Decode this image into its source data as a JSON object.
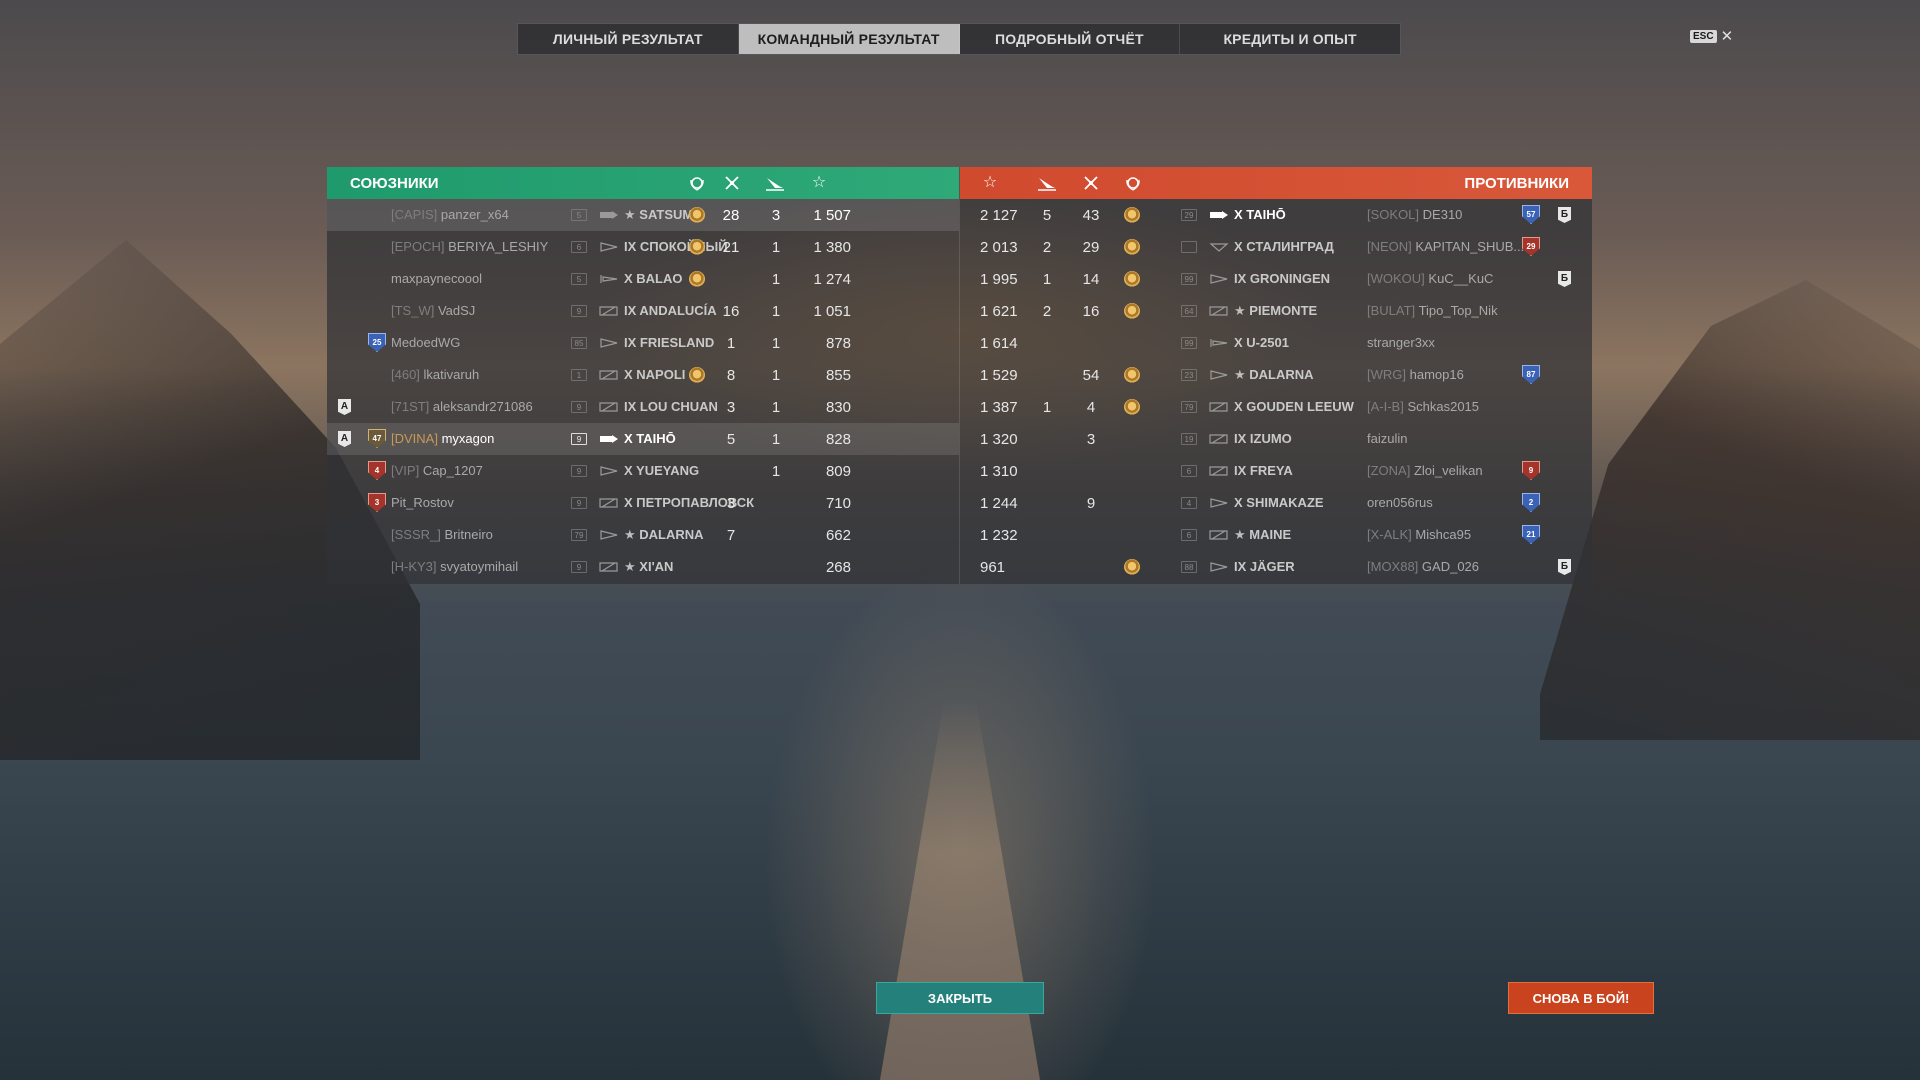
{
  "tabs": [
    {
      "label": "ЛИЧНЫЙ РЕЗУЛЬТАТ",
      "active": false
    },
    {
      "label": "КОМАНДНЫЙ РЕЗУЛЬТАТ",
      "active": true
    },
    {
      "label": "ПОДРОБНЫЙ ОТЧЁТ",
      "active": false
    },
    {
      "label": "КРЕДИТЫ И ОПЫТ",
      "active": false
    }
  ],
  "esc": {
    "key": "ESC",
    "close": "✕"
  },
  "allies": {
    "title": "СОЮЗНИКИ",
    "header_icons": [
      "medal-icon",
      "kills-icon",
      "ribbon-icon",
      "xp-star-icon"
    ],
    "color": "#2fa978",
    "rows": [
      {
        "division": "",
        "badge": "",
        "clan": "[CAPIS]",
        "name": "panzer_x64",
        "tier_badge": "5",
        "ship_class": "carrier",
        "ship": "SATSUMA",
        "ship_prefix": "★",
        "medal": true,
        "kills": "28",
        "ribbons": "3",
        "xp": "1 507",
        "highlight": "top"
      },
      {
        "division": "",
        "badge": "",
        "clan": "[EPOCH]",
        "name": "BERIYA_LESHIY",
        "tier_badge": "6",
        "ship_class": "destroyer",
        "ship": "IX СПОКОЙНЫЙ",
        "ship_prefix": "",
        "medal": true,
        "kills": "21",
        "ribbons": "1",
        "xp": "1 380",
        "highlight": ""
      },
      {
        "division": "",
        "badge": "",
        "clan": "",
        "name": "maxpaynecoool",
        "tier_badge": "5",
        "ship_class": "submarine",
        "ship": "X BALAO",
        "ship_prefix": "",
        "medal": true,
        "kills": "",
        "ribbons": "1",
        "xp": "1 274",
        "highlight": ""
      },
      {
        "division": "",
        "badge": "",
        "clan": "[TS_W]",
        "name": "VadSJ",
        "tier_badge": "9",
        "ship_class": "cruiser",
        "ship": "IX ANDALUCÍA",
        "ship_prefix": "",
        "medal": false,
        "kills": "16",
        "ribbons": "1",
        "xp": "1 051",
        "highlight": ""
      },
      {
        "division": "",
        "badge": "25",
        "badge_color": "blue",
        "clan": "",
        "name": "MedoedWG",
        "tier_badge": "85",
        "ship_class": "destroyer",
        "ship": "IX FRIESLAND",
        "ship_prefix": "",
        "medal": false,
        "kills": "1",
        "ribbons": "1",
        "xp": "878",
        "highlight": ""
      },
      {
        "division": "",
        "badge": "",
        "clan": "[460]",
        "name": "lkativaruh",
        "tier_badge": "1",
        "ship_class": "cruiser",
        "ship": "X NAPOLI",
        "ship_prefix": "",
        "medal": true,
        "kills": "8",
        "ribbons": "1",
        "xp": "855",
        "highlight": ""
      },
      {
        "division": "A",
        "badge": "",
        "clan": "[71ST]",
        "name": "aleksandr271086",
        "tier_badge": "9",
        "ship_class": "cruiser",
        "ship": "IX LOU CHUAN",
        "ship_prefix": "",
        "medal": false,
        "kills": "3",
        "ribbons": "1",
        "xp": "830",
        "highlight": ""
      },
      {
        "division": "A",
        "badge": "47",
        "badge_color": "gold",
        "clan": "[DVINA]",
        "name": "myxagon",
        "tier_badge": "9",
        "ship_class": "carrier",
        "ship": "X TAIHŌ",
        "ship_prefix": "",
        "medal": false,
        "kills": "5",
        "ribbons": "1",
        "xp": "828",
        "highlight": "self"
      },
      {
        "division": "",
        "badge": "4",
        "badge_color": "red",
        "clan": "[VIP]",
        "name": "Cap_1207",
        "tier_badge": "9",
        "ship_class": "destroyer",
        "ship": "X YUEYANG",
        "ship_prefix": "",
        "medal": false,
        "kills": "",
        "ribbons": "1",
        "xp": "809",
        "highlight": ""
      },
      {
        "division": "",
        "badge": "3",
        "badge_color": "red",
        "clan": "",
        "name": "Pit_Rostov",
        "tier_badge": "9",
        "ship_class": "cruiser",
        "ship": "X ПЕТРОПАВЛОВСК",
        "ship_prefix": "",
        "medal": false,
        "kills": "3",
        "ribbons": "",
        "xp": "710",
        "highlight": ""
      },
      {
        "division": "",
        "badge": "",
        "clan": "[SSSR_]",
        "name": "Britneiro",
        "tier_badge": "79",
        "ship_class": "destroyer",
        "ship": "DALARNA",
        "ship_prefix": "★",
        "medal": false,
        "kills": "7",
        "ribbons": "",
        "xp": "662",
        "highlight": ""
      },
      {
        "division": "",
        "badge": "",
        "clan": "[H-KY3]",
        "name": "svyatoymihail",
        "tier_badge": "9",
        "ship_class": "cruiser",
        "ship": "XI'AN",
        "ship_prefix": "★",
        "medal": false,
        "kills": "",
        "ribbons": "",
        "xp": "268",
        "highlight": ""
      }
    ]
  },
  "enemies": {
    "title": "ПРОТИВНИКИ",
    "header_icons": [
      "xp-star-icon",
      "ribbon-icon",
      "kills-icon",
      "medal-icon"
    ],
    "color": "#d9583a",
    "rows": [
      {
        "xp": "2 127",
        "ribbons": "5",
        "kills": "43",
        "medal": true,
        "tier_badge": "29",
        "ship_class": "carrier",
        "ship": "X TAIHŌ",
        "ship_prefix": "",
        "clan": "[SOKOL]",
        "name": "DE310",
        "badge": "57",
        "badge_color": "blue",
        "division": "Б"
      },
      {
        "xp": "2 013",
        "ribbons": "2",
        "kills": "29",
        "medal": true,
        "tier_badge": "",
        "ship_class": "battleship",
        "ship": "X СТАЛИНГРАД",
        "ship_prefix": "",
        "clan": "[NEON]",
        "name": "KAPITAN_SHUB...",
        "badge": "29",
        "badge_color": "red",
        "division": ""
      },
      {
        "xp": "1 995",
        "ribbons": "1",
        "kills": "14",
        "medal": true,
        "tier_badge": "99",
        "ship_class": "destroyer",
        "ship": "IX GRONINGEN",
        "ship_prefix": "",
        "clan": "[WOKOU]",
        "name": "KuC__KuC",
        "badge": "",
        "division": "Б"
      },
      {
        "xp": "1 621",
        "ribbons": "2",
        "kills": "16",
        "medal": true,
        "tier_badge": "64",
        "ship_class": "cruiser",
        "ship": "PIEMONTE",
        "ship_prefix": "★",
        "clan": "[BULAT]",
        "name": "Tipo_Top_Nik",
        "badge": "",
        "division": ""
      },
      {
        "xp": "1 614",
        "ribbons": "",
        "kills": "",
        "medal": false,
        "tier_badge": "99",
        "ship_class": "submarine",
        "ship": "X U-2501",
        "ship_prefix": "",
        "clan": "",
        "name": "stranger3xx",
        "badge": "",
        "division": ""
      },
      {
        "xp": "1 529",
        "ribbons": "",
        "kills": "54",
        "medal": true,
        "tier_badge": "23",
        "ship_class": "destroyer",
        "ship": "DALARNA",
        "ship_prefix": "★",
        "clan": "[WRG]",
        "name": "hamop16",
        "badge": "87",
        "badge_color": "blue",
        "division": ""
      },
      {
        "xp": "1 387",
        "ribbons": "1",
        "kills": "4",
        "medal": true,
        "tier_badge": "79",
        "ship_class": "cruiser",
        "ship": "X GOUDEN LEEUW",
        "ship_prefix": "",
        "clan": "[A-I-B]",
        "name": "Schkas2015",
        "badge": "",
        "division": ""
      },
      {
        "xp": "1 320",
        "ribbons": "",
        "kills": "3",
        "medal": false,
        "tier_badge": "19",
        "ship_class": "cruiser",
        "ship": "IX IZUMO",
        "ship_prefix": "",
        "clan": "",
        "name": "faizulin",
        "badge": "",
        "division": ""
      },
      {
        "xp": "1 310",
        "ribbons": "",
        "kills": "",
        "medal": false,
        "tier_badge": "6",
        "ship_class": "cruiser",
        "ship": "IX FREYA",
        "ship_prefix": "",
        "clan": "[ZONA]",
        "name": "Zloi_velikan",
        "badge": "9",
        "badge_color": "red",
        "division": ""
      },
      {
        "xp": "1 244",
        "ribbons": "",
        "kills": "9",
        "medal": false,
        "tier_badge": "4",
        "ship_class": "destroyer",
        "ship": "X SHIMAKAZE",
        "ship_prefix": "",
        "clan": "",
        "name": "oren056rus",
        "badge": "2",
        "badge_color": "blue",
        "division": ""
      },
      {
        "xp": "1 232",
        "ribbons": "",
        "kills": "",
        "medal": false,
        "tier_badge": "6",
        "ship_class": "cruiser",
        "ship": "MAINE",
        "ship_prefix": "★",
        "clan": "[X-ALK]",
        "name": "Mishca95",
        "badge": "21",
        "badge_color": "blue",
        "division": ""
      },
      {
        "xp": "961",
        "ribbons": "",
        "kills": "",
        "medal": true,
        "tier_badge": "88",
        "ship_class": "destroyer",
        "ship": "IX JÄGER",
        "ship_prefix": "",
        "clan": "[MOX88]",
        "name": "GAD_026",
        "badge": "",
        "division": "Б"
      }
    ]
  },
  "buttons": {
    "close": "ЗАКРЫТЬ",
    "battle": "СНОВА В БОЙ!"
  }
}
